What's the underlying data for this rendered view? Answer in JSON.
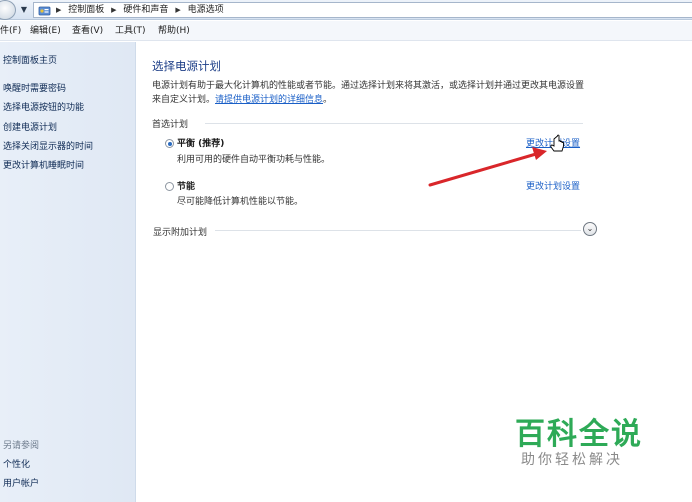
{
  "breadcrumbs": [
    "控制面板",
    "硬件和声音",
    "电源选项"
  ],
  "menu": [
    {
      "label": "件(F)"
    },
    {
      "label": "编辑(E)"
    },
    {
      "label": "查看(V)"
    },
    {
      "label": "工具(T)"
    },
    {
      "label": "帮助(H)"
    }
  ],
  "sidebar": {
    "home": "控制面板主页",
    "links": [
      "唤醒时需要密码",
      "选择电源按钮的功能",
      "创建电源计划",
      "选择关闭显示器的时间",
      "更改计算机睡眠时间"
    ],
    "see_also_label": "另请参阅",
    "see_also": [
      "个性化",
      "用户帐户"
    ]
  },
  "main": {
    "title": "选择电源计划",
    "desc_line1": "电源计划有助于最大化计算机的性能或者节能。通过选择计划来将其激活，或选择计划并通过更改其电源设置",
    "desc_line2_prefix": "来自定义计划。",
    "desc_link": "请提供电源计划的详细信息",
    "desc_line2_suffix": "。",
    "preferred_label": "首选计划",
    "plans": [
      {
        "name": "平衡 (推荐)",
        "desc": "利用可用的硬件自动平衡功耗与性能。",
        "link": "更改计划设置",
        "selected": true
      },
      {
        "name": "节能",
        "desc": "尽可能降低计算机性能以节能。",
        "link": "更改计划设置",
        "selected": false
      }
    ],
    "show_more": "显示附加计划"
  },
  "watermark": {
    "title": "百科全说",
    "subtitle": "助你轻松解决"
  },
  "colors": {
    "link": "#1a5fc7",
    "title": "#1e3f88",
    "arrow": "#d9262a",
    "watermark_green": "#2eaa57"
  }
}
